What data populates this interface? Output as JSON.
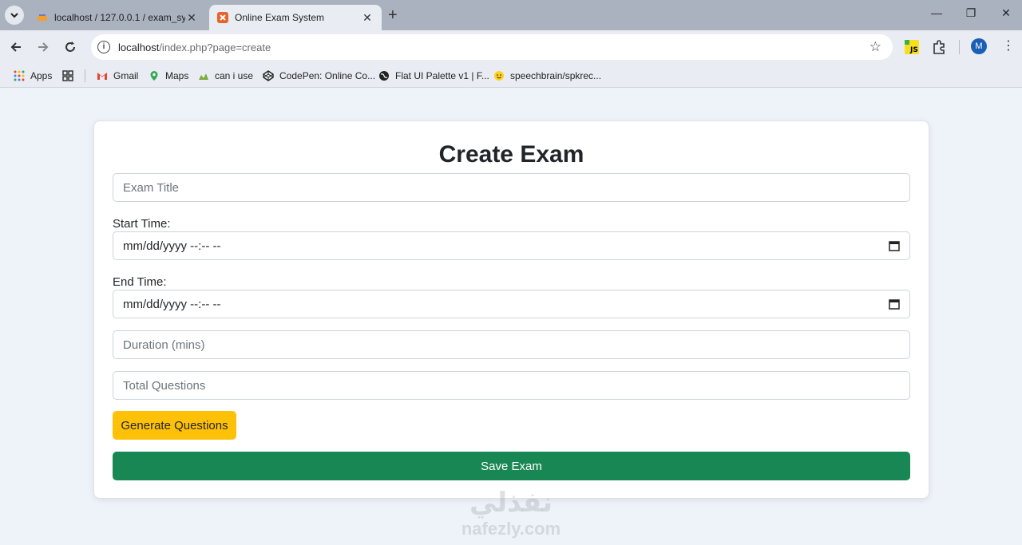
{
  "browser": {
    "tabs": [
      {
        "title": "localhost / 127.0.0.1 / exam_sys",
        "active": false
      },
      {
        "title": "Online Exam System",
        "active": true
      }
    ],
    "new_tab_label": "+",
    "url_host": "localhost",
    "url_path": "/index.php?page=create",
    "profile_initial": "M",
    "extension_label": "JS",
    "bookmarks": [
      "Apps",
      "Gmail",
      "Maps",
      "can i use",
      "CodePen: Online Co...",
      "Flat UI Palette v1 | F...",
      "speechbrain/spkrec..."
    ]
  },
  "form": {
    "heading": "Create Exam",
    "exam_title_placeholder": "Exam Title",
    "start_time_label": "Start Time:",
    "start_time_value": "mm/dd/yyyy --:-- --",
    "end_time_label": "End Time:",
    "end_time_value": "mm/dd/yyyy --:-- --",
    "duration_placeholder": "Duration (mins)",
    "total_questions_placeholder": "Total Questions",
    "generate_button": "Generate Questions",
    "save_button": "Save Exam"
  },
  "watermark": {
    "line1": "نفذلي",
    "line2": "nafezly.com"
  },
  "colors": {
    "accent_save": "#198754",
    "accent_generate": "#ffc107",
    "page_bg": "#eef2f9"
  }
}
